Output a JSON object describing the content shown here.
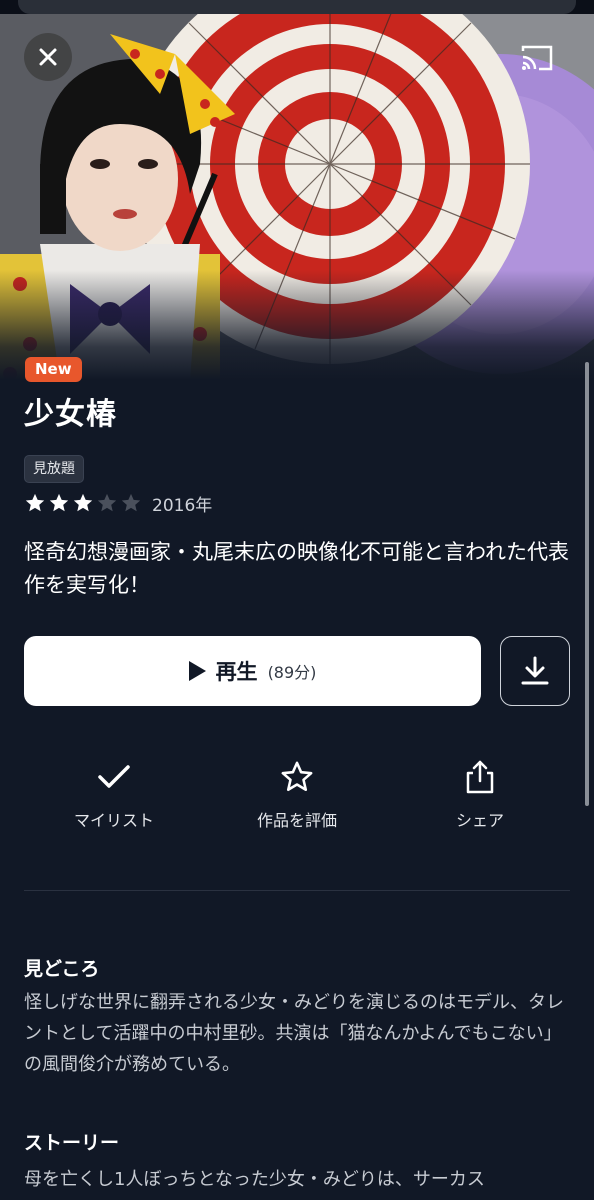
{
  "header": {
    "close_icon": "close-icon",
    "cast_icon": "cast-icon"
  },
  "title": {
    "badge": "New",
    "name": "少女椿",
    "tag": "見放題",
    "rating": 3,
    "rating_max": 5,
    "year": "2016年"
  },
  "description": "怪奇幻想漫画家・丸尾末広の映像化不可能と言われた代表作を実写化！",
  "play": {
    "label": "再生",
    "duration": "(89分)"
  },
  "download_icon": "download-icon",
  "actions": [
    {
      "label": "マイリスト",
      "icon": "check-icon"
    },
    {
      "label": "作品を評価",
      "icon": "star-outline-icon"
    },
    {
      "label": "シェア",
      "icon": "share-icon"
    }
  ],
  "highlights": {
    "heading": "見どころ",
    "body": "怪しげな世界に翻弄される少女・みどりを演じるのはモデル、タレントとして活躍中の中村里砂。共演は「猫なんかよんでもこない」の風間俊介が務めている。"
  },
  "story": {
    "heading": "ストーリー",
    "body": "母を亡くし1人ぼっちとなった少女・みどりは、サーカス"
  },
  "colors": {
    "background": "#111826",
    "badge": "#e8572c",
    "play_button": "#ffffff"
  }
}
